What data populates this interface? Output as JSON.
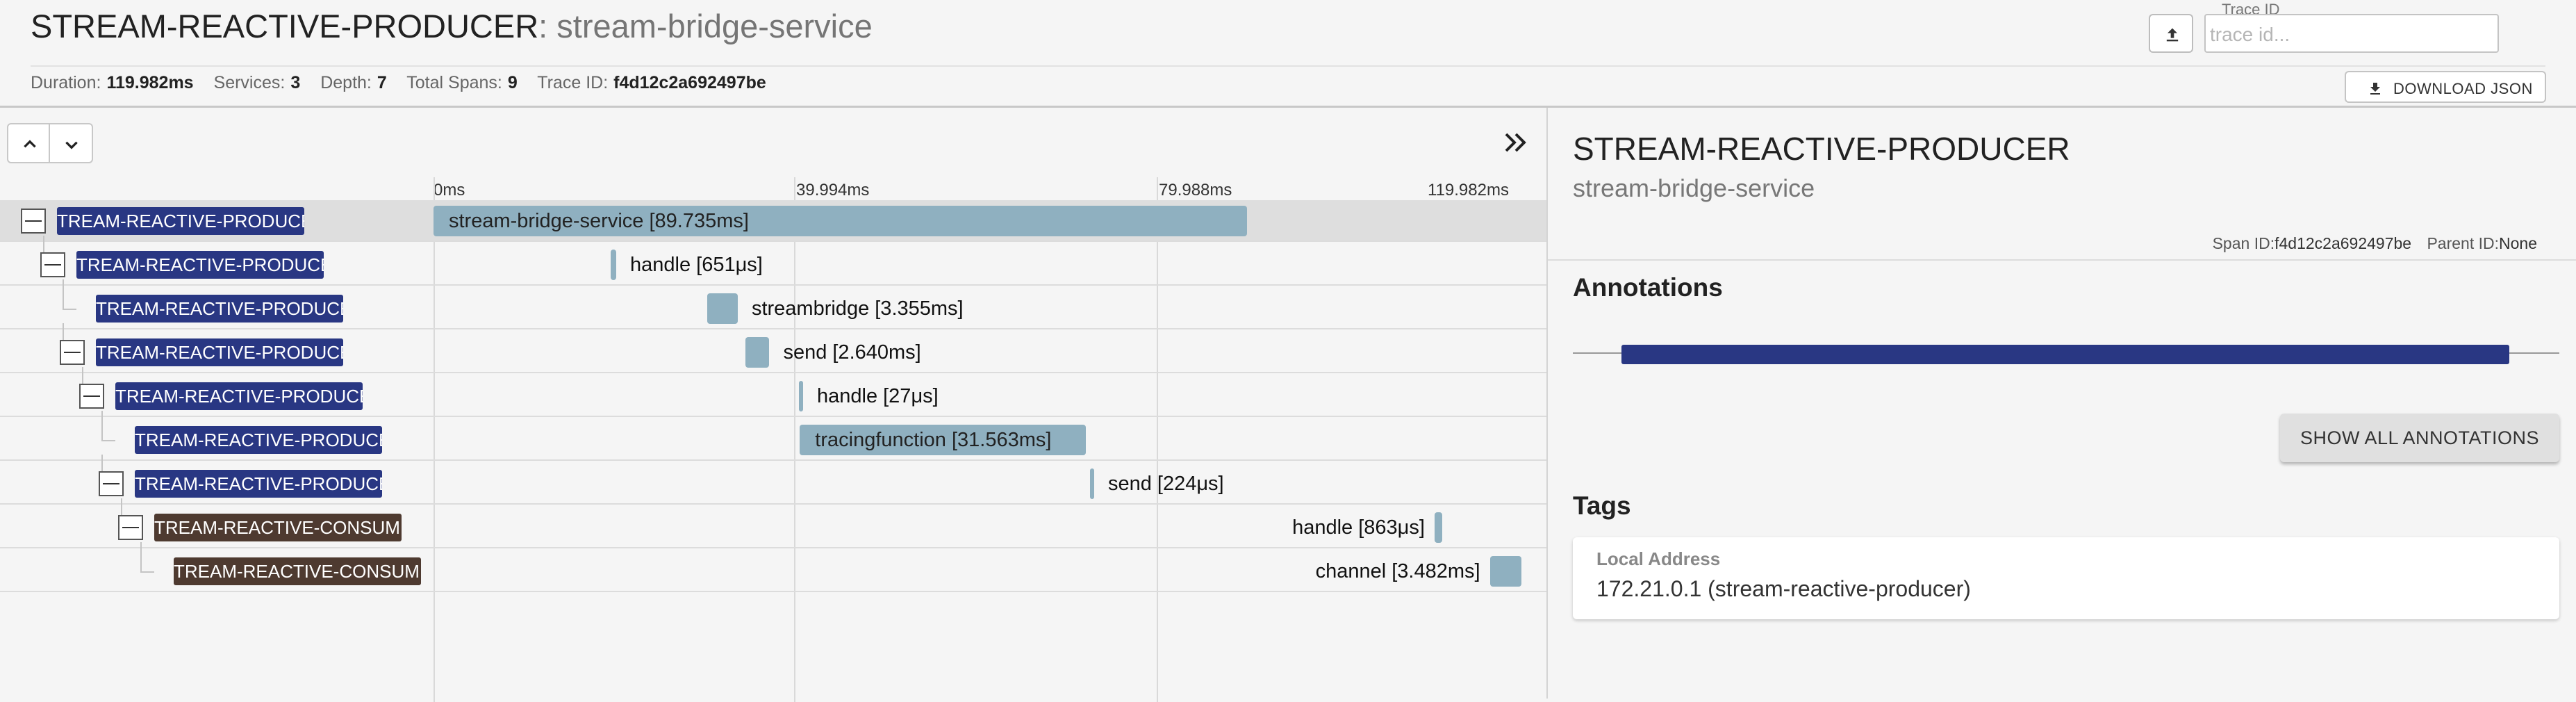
{
  "header": {
    "service": "STREAM-REACTIVE-PRODUCER",
    "separator": ":",
    "span": "stream-bridge-service",
    "trace_id_label": "Trace ID",
    "trace_id_placeholder": "trace id...",
    "download_label": "DOWNLOAD JSON",
    "upload_icon": "upload-icon",
    "download_icon": "download-icon"
  },
  "meta": {
    "duration_label": "Duration:",
    "duration": "119.982ms",
    "services_label": "Services:",
    "services": "3",
    "depth_label": "Depth:",
    "depth": "7",
    "spans_label": "Total Spans:",
    "spans": "9",
    "traceid_label": "Trace ID:",
    "traceid": "f4d12c2a692497be"
  },
  "timeline": {
    "ticks": [
      "0ms",
      "39.994ms",
      "79.988ms",
      "119.982ms"
    ],
    "total_ms": 119.982,
    "rows": [
      {
        "service": "TREAM-REACTIVE-PRODUCE",
        "kind": "producer",
        "depth": 0,
        "collapsible": true,
        "label": "stream-bridge-service [89.735ms]",
        "start_ms": 0,
        "duration_ms": 89.735,
        "selected": true
      },
      {
        "service": "TREAM-REACTIVE-PRODUCE",
        "kind": "producer",
        "depth": 1,
        "collapsible": true,
        "label": "handle [651μs]",
        "start_ms": 19.5,
        "duration_ms": 0.651,
        "selected": false
      },
      {
        "service": "TREAM-REACTIVE-PRODUCE",
        "kind": "producer",
        "depth": 2,
        "collapsible": false,
        "label": "streambridge [3.355ms]",
        "start_ms": 30.2,
        "duration_ms": 3.355,
        "selected": false
      },
      {
        "service": "TREAM-REACTIVE-PRODUCE",
        "kind": "producer",
        "depth": 2,
        "collapsible": true,
        "label": "send [2.640ms]",
        "start_ms": 34.4,
        "duration_ms": 2.64,
        "selected": false
      },
      {
        "service": "TREAM-REACTIVE-PRODUCE",
        "kind": "producer",
        "depth": 3,
        "collapsible": true,
        "label": "handle [27μs]",
        "start_ms": 40.3,
        "duration_ms": 0.027,
        "selected": false
      },
      {
        "service": "TREAM-REACTIVE-PRODUCE",
        "kind": "producer",
        "depth": 4,
        "collapsible": false,
        "label": "tracingfunction [31.563ms]",
        "start_ms": 40.4,
        "duration_ms": 31.563,
        "selected": false
      },
      {
        "service": "TREAM-REACTIVE-PRODUCE",
        "kind": "producer",
        "depth": 4,
        "collapsible": true,
        "label": "send [224μs]",
        "start_ms": 72.4,
        "duration_ms": 0.224,
        "selected": false
      },
      {
        "service": "TREAM-REACTIVE-CONSUME",
        "kind": "consumer",
        "depth": 5,
        "collapsible": true,
        "label": "handle [863μs]",
        "start_ms": 110.4,
        "duration_ms": 0.863,
        "selected": false
      },
      {
        "service": "TREAM-REACTIVE-CONSUME",
        "kind": "consumer",
        "depth": 6,
        "collapsible": false,
        "label": "channel [3.482ms]",
        "start_ms": 116.5,
        "duration_ms": 3.482,
        "selected": false
      }
    ]
  },
  "detail": {
    "service": "STREAM-REACTIVE-PRODUCER",
    "span": "stream-bridge-service",
    "span_id_label": "Span ID:",
    "span_id": "f4d12c2a692497be",
    "parent_id_label": "Parent ID:",
    "parent_id": "None",
    "annotations_title": "Annotations",
    "annotation_start_fraction": 0.049,
    "annotation_end_fraction": 0.949,
    "show_annotations_label": "SHOW ALL ANNOTATIONS",
    "tags_title": "Tags",
    "tags": [
      {
        "key": "Local Address",
        "value": "172.21.0.1 (stream-reactive-producer)"
      }
    ]
  },
  "colors": {
    "producer": "#293783",
    "consumer": "#4e3a30",
    "span_bar": "#8fb0c0",
    "selected_row": "#dedede"
  }
}
